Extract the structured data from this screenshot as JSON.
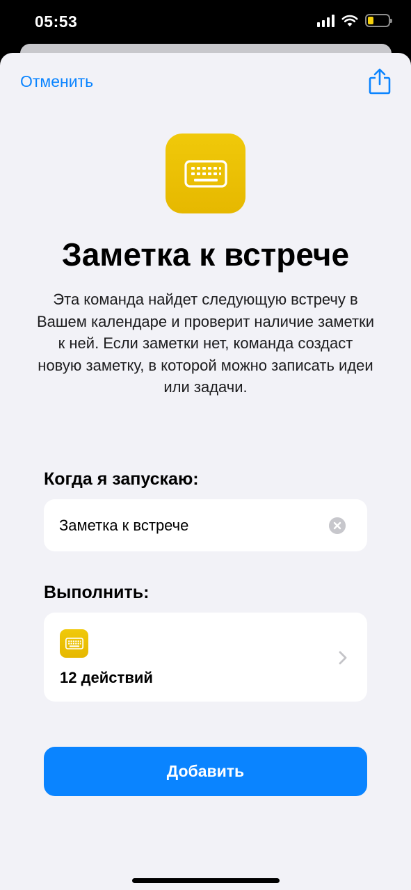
{
  "status_bar": {
    "time": "05:53"
  },
  "header": {
    "cancel_label": "Отменить"
  },
  "shortcut": {
    "title": "Заметка к встрече",
    "description": "Эта команда найдет следующую встречу в Вашем календаре и проверит наличие заметки к ней. Если заметки нет, команда создаст новую заметку, в которой можно записать идеи или задачи.",
    "icon": "keyboard-icon",
    "icon_color": "#EEC60A"
  },
  "trigger_section": {
    "label": "Когда я запускаю:",
    "phrase_value": "Заметка к встрече"
  },
  "actions_section": {
    "label": "Выполнить:",
    "count_label": "12 действий"
  },
  "add_button": {
    "label": "Добавить"
  },
  "colors": {
    "accent": "#0A84FF",
    "sheet_background": "#F2F2F7"
  }
}
